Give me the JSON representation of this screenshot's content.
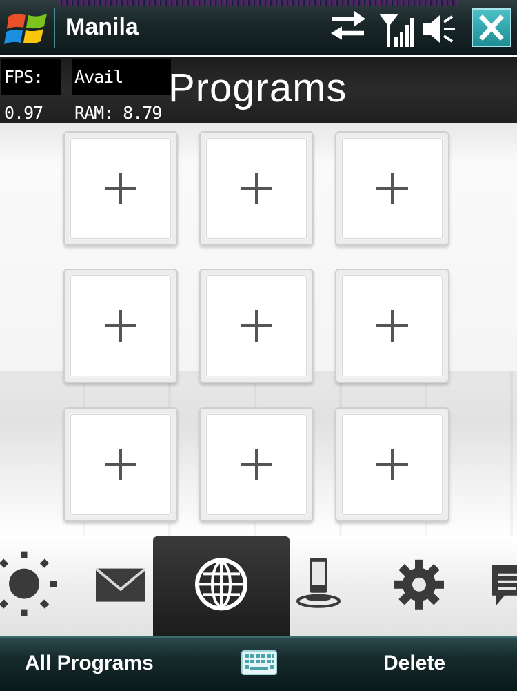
{
  "titlebar": {
    "title": "Manila",
    "icons": {
      "start": "windows-start-icon",
      "connectivity": "data-sync-arrows-icon",
      "signal": "signal-strength-icon",
      "volume": "speaker-volume-icon",
      "close": "close-x-icon"
    }
  },
  "overlay": {
    "fps": "FPS: 0.97",
    "ram": "Avail RAM: 8.79"
  },
  "page": {
    "title": "Programs"
  },
  "grid": {
    "slots": [
      {
        "icon": "plus-icon"
      },
      {
        "icon": "plus-icon"
      },
      {
        "icon": "plus-icon"
      },
      {
        "icon": "plus-icon"
      },
      {
        "icon": "plus-icon"
      },
      {
        "icon": "plus-icon"
      },
      {
        "icon": "plus-icon"
      },
      {
        "icon": "plus-icon"
      },
      {
        "icon": "plus-icon"
      }
    ]
  },
  "tabs": {
    "items": [
      {
        "icon": "weather-sun-icon"
      },
      {
        "icon": "mail-envelope-icon"
      },
      {
        "icon": "internet-globe-icon",
        "active": true
      },
      {
        "icon": "phone-dock-icon"
      },
      {
        "icon": "settings-gear-icon"
      },
      {
        "icon": "message-bubble-icon"
      }
    ]
  },
  "softkeys": {
    "left": "All Programs",
    "center_icon": "keyboard-icon",
    "right": "Delete"
  },
  "colors": {
    "accent": "#2a9aa1",
    "titlebar_bg": "#1a2729",
    "header_bg": "#242424"
  }
}
